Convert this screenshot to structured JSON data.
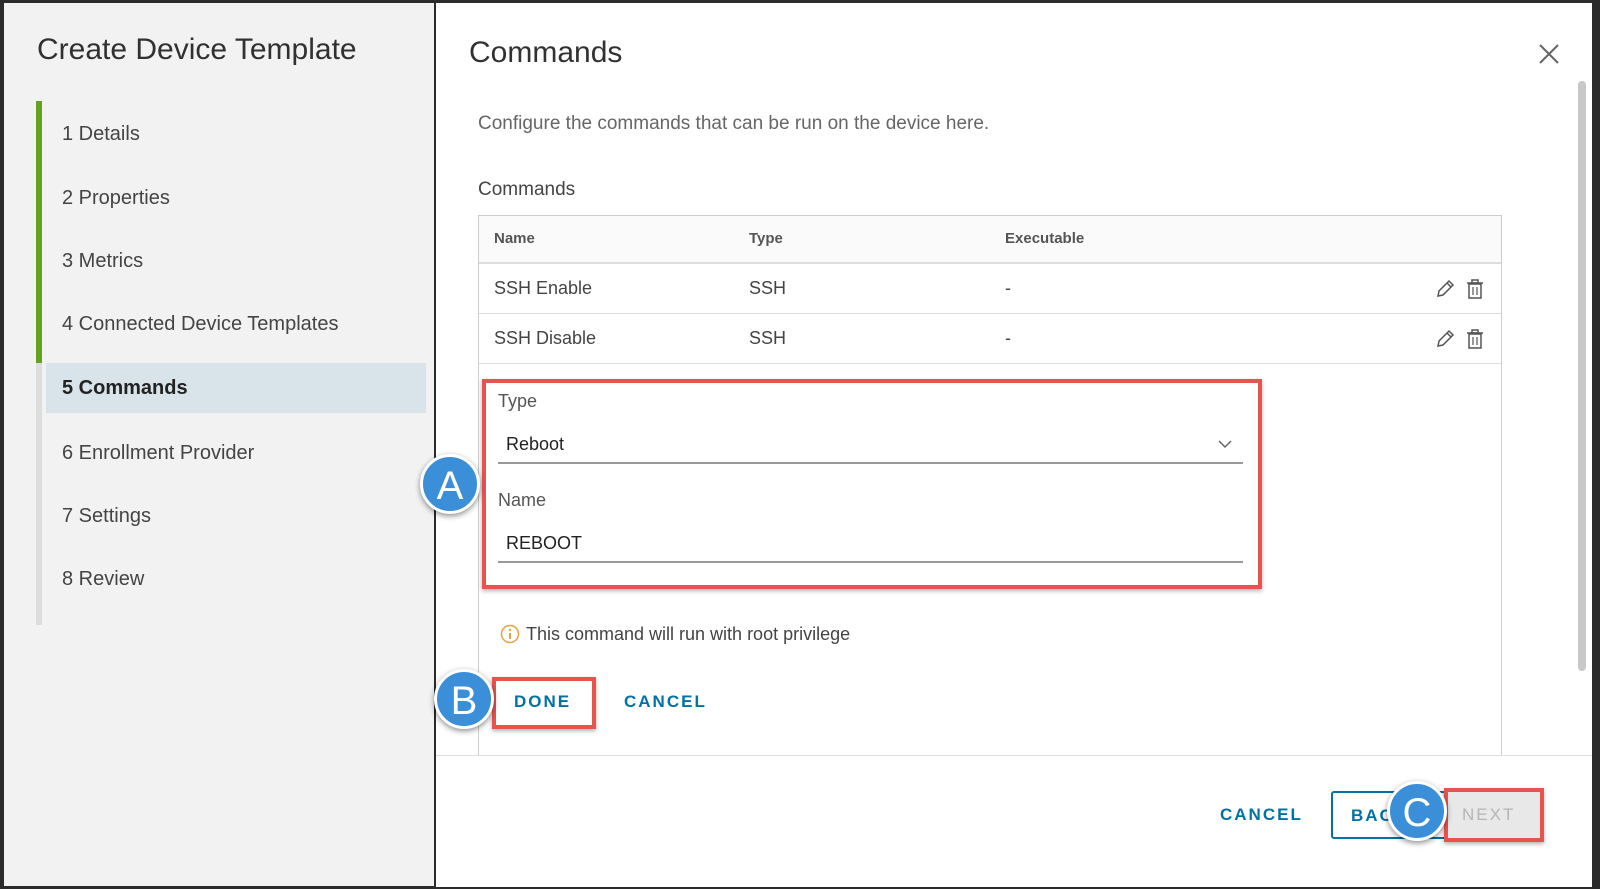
{
  "wizard": {
    "title": "Create Device Template",
    "steps": [
      {
        "label": "1  Details"
      },
      {
        "label": "2  Properties"
      },
      {
        "label": "3  Metrics"
      },
      {
        "label": "4  Connected Device Templates"
      },
      {
        "label": "5  Commands"
      },
      {
        "label": "6  Enrollment Provider"
      },
      {
        "label": "7  Settings"
      },
      {
        "label": "8  Review"
      }
    ]
  },
  "main": {
    "title": "Commands",
    "description": "Configure the commands that can be run on the device here.",
    "section_label": "Commands",
    "table": {
      "headers": [
        "Name",
        "Type",
        "Executable"
      ],
      "rows": [
        {
          "name": "SSH Enable",
          "type": "SSH",
          "executable": "-"
        },
        {
          "name": "SSH Disable",
          "type": "SSH",
          "executable": "-"
        }
      ]
    },
    "form": {
      "type_label": "Type",
      "type_value": "Reboot",
      "name_label": "Name",
      "name_value": "REBOOT"
    },
    "info_text": "This command will run with root privilege",
    "done_label": "DONE",
    "cancel_inline_label": "CANCEL"
  },
  "footer": {
    "cancel_label": "CANCEL",
    "back_label": "BACK",
    "next_label": "NEXT"
  },
  "callouts": {
    "a": "A",
    "b": "B",
    "c": "C"
  },
  "colors": {
    "accent": "#0072a3",
    "progress": "#62a420",
    "highlight": "#e8524f",
    "callout": "#3b8ed8"
  }
}
